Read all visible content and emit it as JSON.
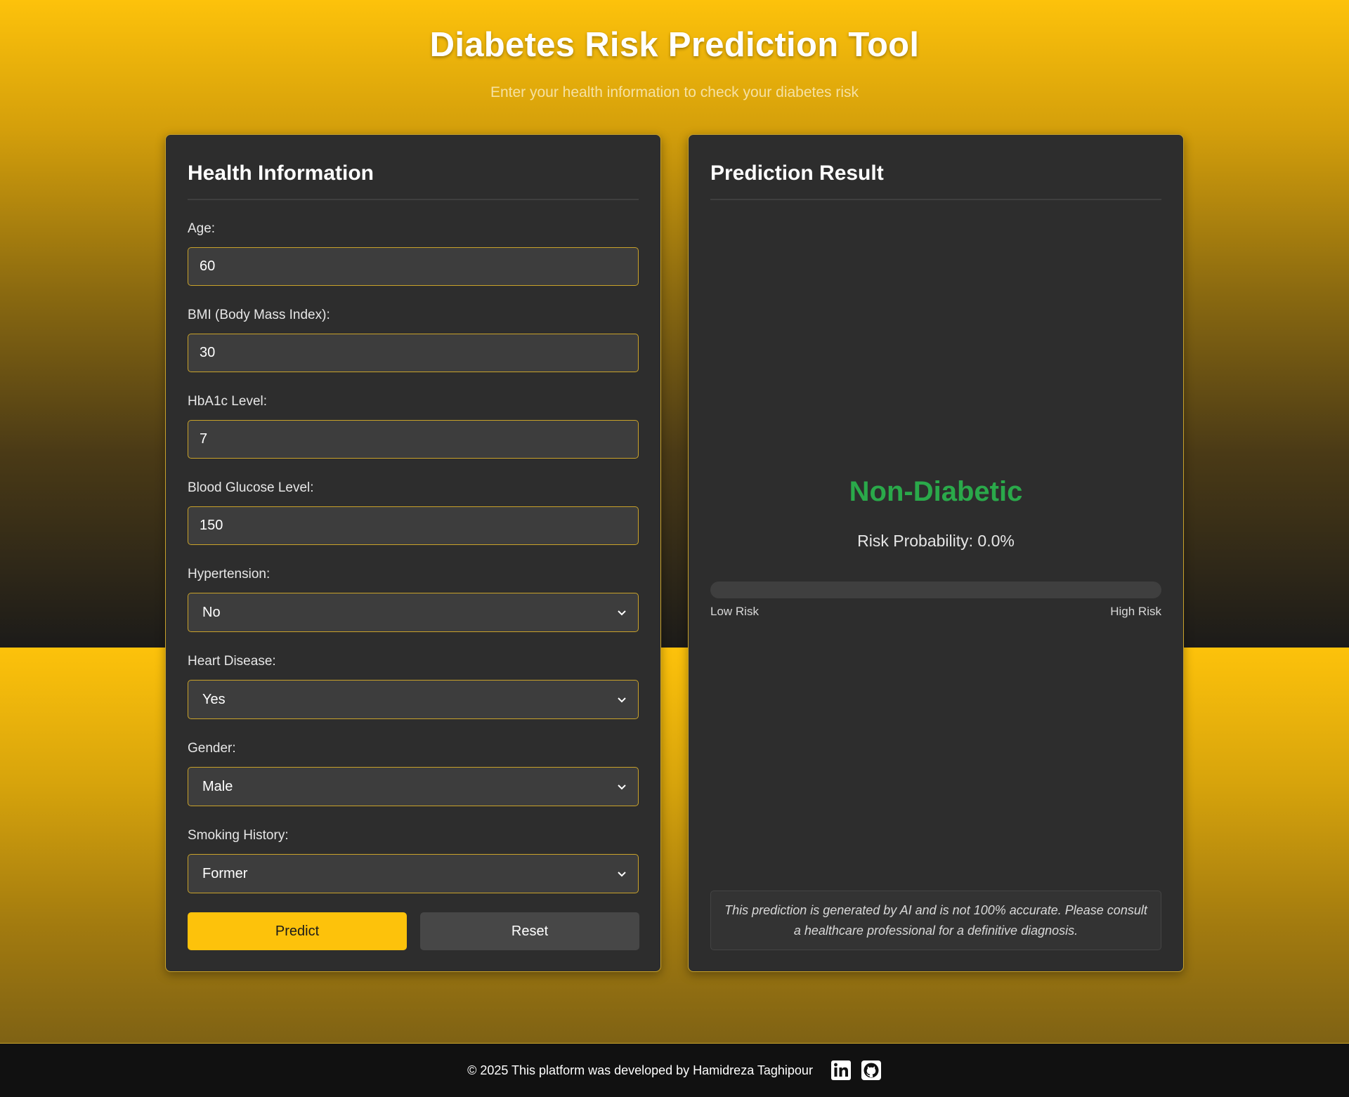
{
  "header": {
    "title": "Diabetes Risk Prediction Tool",
    "subtitle": "Enter your health information to check your diabetes risk"
  },
  "form": {
    "title": "Health Information",
    "fields": [
      {
        "label": "Age:",
        "value": "60"
      },
      {
        "label": "BMI (Body Mass Index):",
        "value": "30"
      },
      {
        "label": "HbA1c Level:",
        "value": "7"
      },
      {
        "label": "Blood Glucose Level:",
        "value": "150"
      }
    ],
    "selects": [
      {
        "label": "Hypertension:",
        "value": "No"
      },
      {
        "label": "Heart Disease:",
        "value": "Yes"
      },
      {
        "label": "Gender:",
        "value": "Male"
      },
      {
        "label": "Smoking History:",
        "value": "Former"
      }
    ],
    "predict_label": "Predict",
    "reset_label": "Reset"
  },
  "result": {
    "title": "Prediction Result",
    "label": "Non-Diabetic",
    "probability_text": "Risk Probability: 0.0%",
    "risk_fraction": 0.0,
    "low_label": "Low Risk",
    "high_label": "High Risk",
    "disclaimer": "This prediction is generated by AI and is not 100% accurate. Please consult a healthcare professional for a definitive diagnosis."
  },
  "footer": {
    "text": "© 2025 This platform was developed by Hamidreza Taghipour",
    "icons": [
      "linkedin-icon",
      "github-icon"
    ]
  },
  "colors": {
    "accent": "#fdc20b",
    "card": "#2d2d2d",
    "input": "#3d3d3d",
    "success": "#2aa94a",
    "footer": "#111111"
  }
}
